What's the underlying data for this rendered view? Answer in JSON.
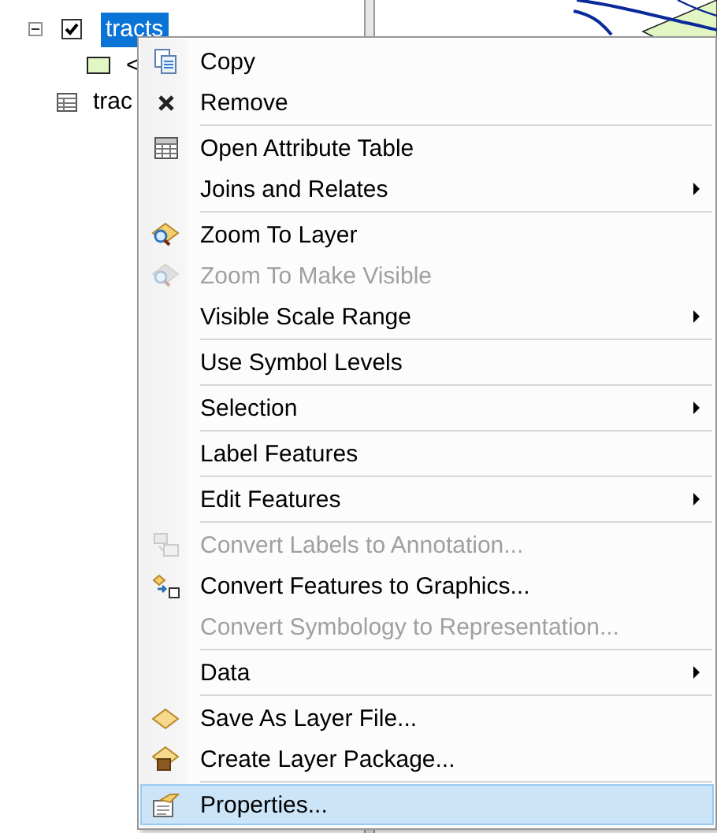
{
  "toc": {
    "items": [
      {
        "kind": "layer",
        "label": "tracts",
        "checked": true,
        "expanded": true,
        "selected": true,
        "children": [
          {
            "kind": "symbol",
            "label": "<"
          }
        ]
      },
      {
        "kind": "table",
        "label": "trac"
      }
    ]
  },
  "context_menu": {
    "groups": [
      [
        {
          "label": "Copy",
          "disabled": false,
          "submenu": false,
          "selected": false
        },
        {
          "label": "Remove",
          "disabled": false,
          "submenu": false,
          "selected": false
        }
      ],
      [
        {
          "label": "Open Attribute Table",
          "disabled": false,
          "submenu": false,
          "selected": false
        },
        {
          "label": "Joins and Relates",
          "disabled": false,
          "submenu": true,
          "selected": false
        }
      ],
      [
        {
          "label": "Zoom To Layer",
          "disabled": false,
          "submenu": false,
          "selected": false
        },
        {
          "label": "Zoom To Make Visible",
          "disabled": true,
          "submenu": false,
          "selected": false
        },
        {
          "label": "Visible Scale Range",
          "disabled": false,
          "submenu": true,
          "selected": false
        }
      ],
      [
        {
          "label": "Use Symbol Levels",
          "disabled": false,
          "submenu": false,
          "selected": false
        }
      ],
      [
        {
          "label": "Selection",
          "disabled": false,
          "submenu": true,
          "selected": false
        }
      ],
      [
        {
          "label": "Label Features",
          "disabled": false,
          "submenu": false,
          "selected": false
        }
      ],
      [
        {
          "label": "Edit Features",
          "disabled": false,
          "submenu": true,
          "selected": false
        }
      ],
      [
        {
          "label": "Convert Labels to Annotation...",
          "disabled": true,
          "submenu": false,
          "selected": false
        },
        {
          "label": "Convert Features to Graphics...",
          "disabled": false,
          "submenu": false,
          "selected": false
        },
        {
          "label": "Convert Symbology to Representation...",
          "disabled": true,
          "submenu": false,
          "selected": false
        }
      ],
      [
        {
          "label": "Data",
          "disabled": false,
          "submenu": true,
          "selected": false
        }
      ],
      [
        {
          "label": "Save As Layer File...",
          "disabled": false,
          "submenu": false,
          "selected": false
        },
        {
          "label": "Create Layer Package...",
          "disabled": false,
          "submenu": false,
          "selected": false
        }
      ],
      [
        {
          "label": "Properties...",
          "disabled": false,
          "submenu": false,
          "selected": true
        }
      ]
    ]
  }
}
